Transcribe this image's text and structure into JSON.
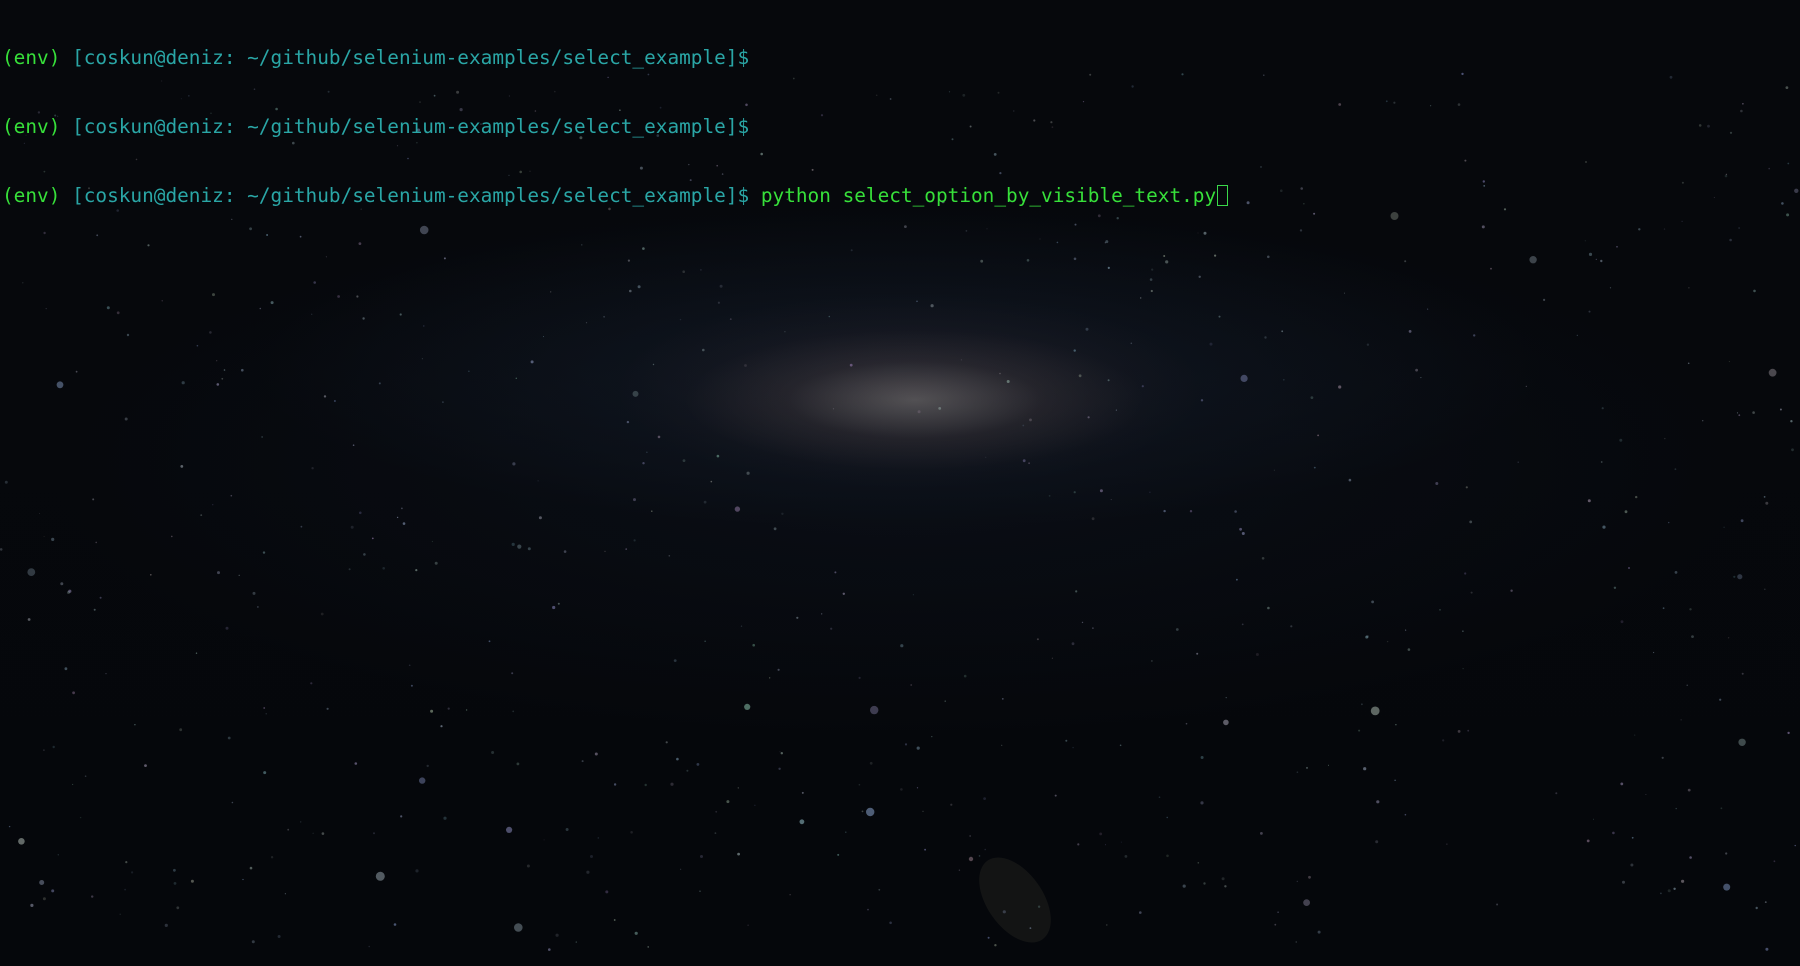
{
  "terminal": {
    "lines": [
      {
        "env": "(env)",
        "prompt": "[coskun@deniz: ~/github/selenium-examples/select_example]$",
        "command": ""
      },
      {
        "env": "(env)",
        "prompt": "[coskun@deniz: ~/github/selenium-examples/select_example]$",
        "command": ""
      },
      {
        "env": "(env)",
        "prompt": "[coskun@deniz: ~/github/selenium-examples/select_example]$",
        "command": "python select_option_by_visible_text.py"
      }
    ]
  },
  "colors": {
    "env_text": "#37e03a",
    "prompt_text": "#2aa6a6",
    "command_text": "#37e03a",
    "background": "#05070b"
  },
  "background_image": "andromeda-galaxy-wallpaper"
}
